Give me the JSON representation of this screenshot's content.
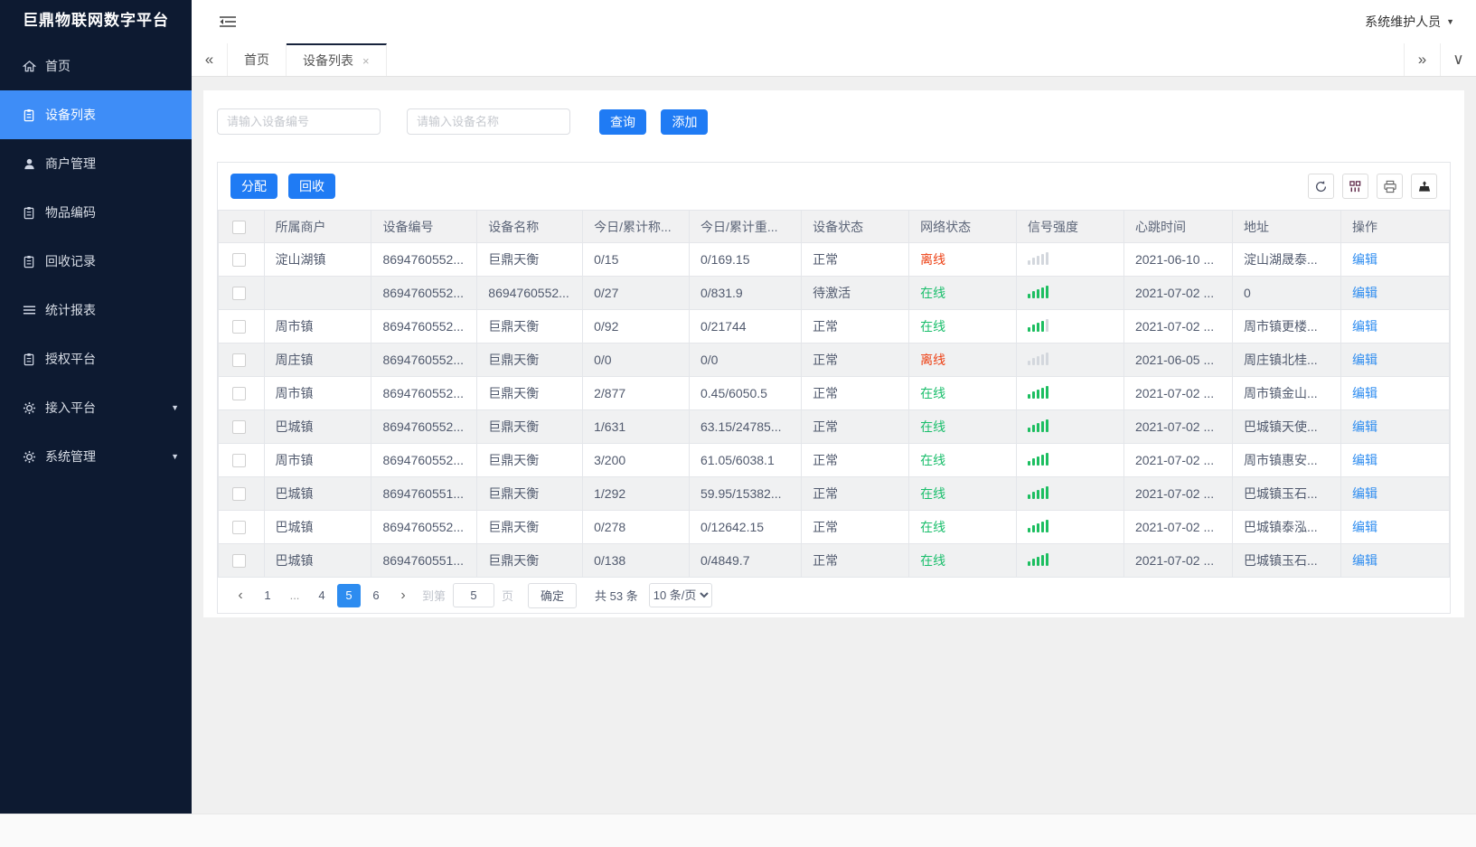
{
  "sidebar": {
    "title": "巨鼎物联网数字平台",
    "items": [
      {
        "label": "首页",
        "icon": "home-icon"
      },
      {
        "label": "设备列表",
        "icon": "clipboard-icon",
        "active": true
      },
      {
        "label": "商户管理",
        "icon": "user-icon"
      },
      {
        "label": "物品编码",
        "icon": "clipboard-icon"
      },
      {
        "label": "回收记录",
        "icon": "clipboard-icon"
      },
      {
        "label": "统计报表",
        "icon": "menu-lines-icon"
      },
      {
        "label": "授权平台",
        "icon": "clipboard-icon"
      },
      {
        "label": "接入平台",
        "icon": "gear-icon",
        "expandable": true
      },
      {
        "label": "系统管理",
        "icon": "gear-icon",
        "expandable": true
      }
    ]
  },
  "header": {
    "user": "系统维护人员"
  },
  "tabs": {
    "items": [
      {
        "label": "首页",
        "active": false
      },
      {
        "label": "设备列表",
        "active": true,
        "closable": true
      }
    ]
  },
  "search": {
    "device_no_placeholder": "请输入设备编号",
    "device_name_placeholder": "请输入设备名称",
    "query_label": "查询",
    "add_label": "添加"
  },
  "toolbar": {
    "assign_label": "分配",
    "recycle_label": "回收",
    "icons": [
      "refresh-icon",
      "columns-icon",
      "printer-icon",
      "export-icon"
    ]
  },
  "table": {
    "columns": [
      "所属商户",
      "设备编号",
      "设备名称",
      "今日/累计称...",
      "今日/累计重...",
      "设备状态",
      "网络状态",
      "信号强度",
      "心跳时间",
      "地址",
      "操作"
    ],
    "edit_label": "编辑",
    "rows": [
      {
        "merchant": "淀山湖镇",
        "device_no": "8694760552...",
        "device_name": "巨鼎天衡",
        "today_count": "0/15",
        "today_weight": "0/169.15",
        "device_status": "正常",
        "network_status": "离线",
        "online": false,
        "signal": 0,
        "heartbeat": "2021-06-10 ...",
        "address": "淀山湖晟泰..."
      },
      {
        "merchant": "",
        "device_no": "8694760552...",
        "device_name": "8694760552...",
        "today_count": "0/27",
        "today_weight": "0/831.9",
        "device_status": "待激活",
        "network_status": "在线",
        "online": true,
        "signal": 5,
        "heartbeat": "2021-07-02 ...",
        "address": "0"
      },
      {
        "merchant": "周市镇",
        "device_no": "8694760552...",
        "device_name": "巨鼎天衡",
        "today_count": "0/92",
        "today_weight": "0/21744",
        "device_status": "正常",
        "network_status": "在线",
        "online": true,
        "signal": 4,
        "heartbeat": "2021-07-02 ...",
        "address": "周市镇更楼..."
      },
      {
        "merchant": "周庄镇",
        "device_no": "8694760552...",
        "device_name": "巨鼎天衡",
        "today_count": "0/0",
        "today_weight": "0/0",
        "device_status": "正常",
        "network_status": "离线",
        "online": false,
        "signal": 0,
        "heartbeat": "2021-06-05 ...",
        "address": "周庄镇北桂..."
      },
      {
        "merchant": "周市镇",
        "device_no": "8694760552...",
        "device_name": "巨鼎天衡",
        "today_count": "2/877",
        "today_weight": "0.45/6050.5",
        "device_status": "正常",
        "network_status": "在线",
        "online": true,
        "signal": 5,
        "heartbeat": "2021-07-02 ...",
        "address": "周市镇金山..."
      },
      {
        "merchant": "巴城镇",
        "device_no": "8694760552...",
        "device_name": "巨鼎天衡",
        "today_count": "1/631",
        "today_weight": "63.15/24785...",
        "device_status": "正常",
        "network_status": "在线",
        "online": true,
        "signal": 5,
        "heartbeat": "2021-07-02 ...",
        "address": "巴城镇天使..."
      },
      {
        "merchant": "周市镇",
        "device_no": "8694760552...",
        "device_name": "巨鼎天衡",
        "today_count": "3/200",
        "today_weight": "61.05/6038.1",
        "device_status": "正常",
        "network_status": "在线",
        "online": true,
        "signal": 5,
        "heartbeat": "2021-07-02 ...",
        "address": "周市镇惠安..."
      },
      {
        "merchant": "巴城镇",
        "device_no": "8694760551...",
        "device_name": "巨鼎天衡",
        "today_count": "1/292",
        "today_weight": "59.95/15382...",
        "device_status": "正常",
        "network_status": "在线",
        "online": true,
        "signal": 5,
        "heartbeat": "2021-07-02 ...",
        "address": "巴城镇玉石..."
      },
      {
        "merchant": "巴城镇",
        "device_no": "8694760552...",
        "device_name": "巨鼎天衡",
        "today_count": "0/278",
        "today_weight": "0/12642.15",
        "device_status": "正常",
        "network_status": "在线",
        "online": true,
        "signal": 5,
        "heartbeat": "2021-07-02 ...",
        "address": "巴城镇泰泓..."
      },
      {
        "merchant": "巴城镇",
        "device_no": "8694760551...",
        "device_name": "巨鼎天衡",
        "today_count": "0/138",
        "today_weight": "0/4849.7",
        "device_status": "正常",
        "network_status": "在线",
        "online": true,
        "signal": 5,
        "heartbeat": "2021-07-02 ...",
        "address": "巴城镇玉石..."
      }
    ]
  },
  "pagination": {
    "pages": [
      "1",
      "...",
      "4",
      "5",
      "6"
    ],
    "active_page": "5",
    "goto_label": "到第",
    "goto_value": "5",
    "page_unit": "页",
    "confirm_label": "确定",
    "total_label": "共 53 条",
    "page_size": "10 条/页"
  },
  "colors": {
    "accent": "#2d8cf0",
    "primary_button": "#1f7bf4",
    "sidebar_bg": "#0d1a31",
    "sidebar_active": "#3e8df7",
    "online_green": "#19be6b",
    "offline_red": "#ed4014"
  }
}
